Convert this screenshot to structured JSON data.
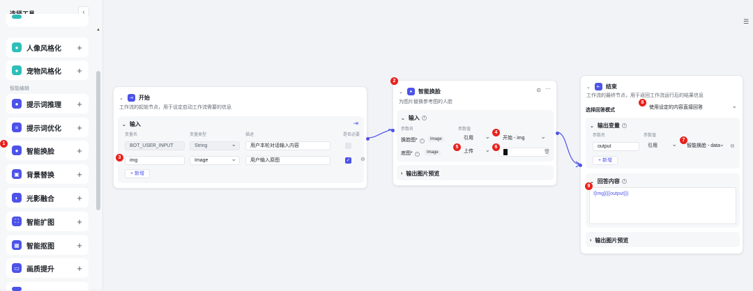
{
  "sidebar": {
    "title": "选择工具",
    "collapse_icon": "chevron-left",
    "section_label": "智能编辑",
    "items": [
      {
        "label": "人像风格化",
        "color": "#2dbfb8",
        "icon": "person-icon"
      },
      {
        "label": "宠物风格化",
        "color": "#2dbfb8",
        "icon": "pet-icon"
      },
      {
        "label": "提示词推理",
        "color": "#4d53e8",
        "icon": "bulb-icon"
      },
      {
        "label": "提示词优化",
        "color": "#4d53e8",
        "icon": "list-icon"
      },
      {
        "label": "智能换脸",
        "color": "#4d53e8",
        "icon": "face-icon"
      },
      {
        "label": "背景替换",
        "color": "#4d53e8",
        "icon": "background-icon"
      },
      {
        "label": "光影融合",
        "color": "#4d53e8",
        "icon": "light-icon"
      },
      {
        "label": "智能扩图",
        "color": "#4d53e8",
        "icon": "expand-icon"
      },
      {
        "label": "智能抠图",
        "color": "#4d53e8",
        "icon": "cutout-icon"
      },
      {
        "label": "画质提升",
        "color": "#4d53e8",
        "icon": "quality-icon"
      }
    ]
  },
  "badges": [
    "1",
    "2",
    "3",
    "4",
    "5",
    "6",
    "7",
    "8",
    "9"
  ],
  "start_node": {
    "title": "开始",
    "desc": "工作流的起始节点，用于设定启动工作流需要的信息",
    "input_title": "输入",
    "col_name": "变量名",
    "col_type": "变量类型",
    "col_desc": "描述",
    "col_required": "是否必要",
    "rows": [
      {
        "name": "BOT_USER_INPUT",
        "type": "String",
        "desc": "用户本轮对话输入内容"
      },
      {
        "name": "img",
        "type": "Image",
        "desc": "用户输入原图"
      }
    ],
    "add_label": "+ 新增"
  },
  "face_node": {
    "title": "智能换脸",
    "desc": "为图片替换参考图的人脸",
    "input_title": "输入",
    "col_name": "参数名",
    "col_value": "参数值",
    "rows": [
      {
        "name": "换脸图*",
        "tag": "Image",
        "mode": "引用",
        "value": "开始 - img"
      },
      {
        "name": "底图*",
        "tag": "Image",
        "mode": "上传",
        "value": ""
      }
    ],
    "preview_label": "输出图片预览"
  },
  "end_node": {
    "title": "结束",
    "desc": "工作流的最终节点，用于返回工作流运行后的结果信息",
    "mode_label": "选择回答模式",
    "mode_value": "使用设定的内容直接回答",
    "output_title": "输出变量",
    "col_name": "参数名",
    "col_value": "参数值",
    "row": {
      "name": "output",
      "mode": "引用",
      "value": "智能换脸 - data"
    },
    "add_label": "+ 新增",
    "answer_title": "回答内容",
    "answer_text": "![img]({{output}})",
    "preview_label": "输出图片预览"
  },
  "colors": {
    "accent": "#4d53e8",
    "badge": "#e8211b",
    "teal": "#2dbfb8"
  }
}
